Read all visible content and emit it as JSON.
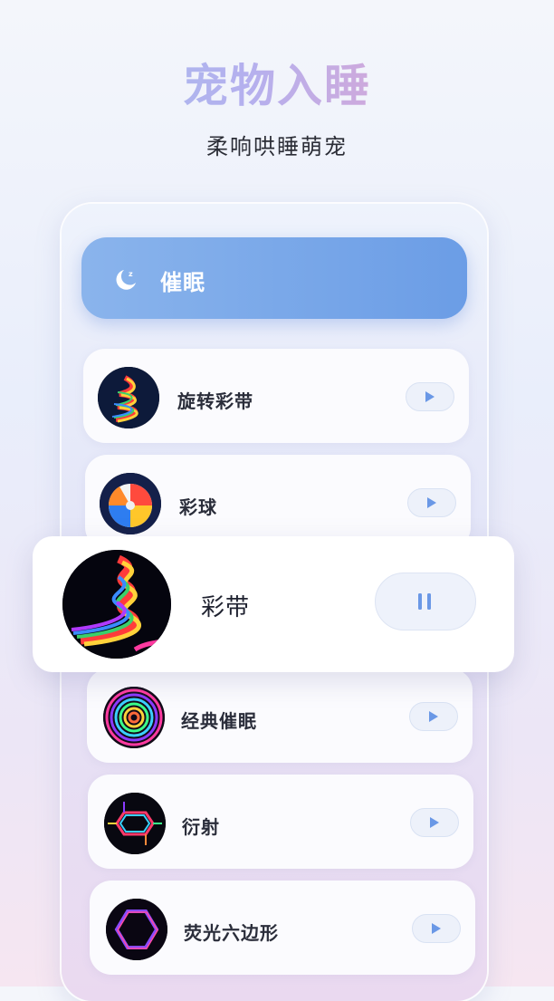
{
  "header": {
    "title": "宠物入睡",
    "subtitle": "柔响哄睡萌宠"
  },
  "mode": {
    "label": "催眠",
    "icon": "moon-sleep-icon"
  },
  "items": [
    {
      "label": "旋转彩带",
      "icon": "rainbow-spiral-thumbnail",
      "state": "play"
    },
    {
      "label": "彩球",
      "icon": "beach-ball-thumbnail",
      "state": "play"
    },
    {
      "label": "经典催眠",
      "icon": "hypnotic-circles-thumbnail",
      "state": "play"
    },
    {
      "label": "衍射",
      "icon": "diffraction-hexagon-thumbnail",
      "state": "play"
    },
    {
      "label": "荧光六边形",
      "icon": "neon-hexagon-thumbnail",
      "state": "play"
    }
  ],
  "now_playing": {
    "label": "彩带",
    "icon": "rainbow-ribbon-thumbnail",
    "state": "pause"
  },
  "colors": {
    "accent": "#6b9de6",
    "title_gradient": [
      "#9fc2ef",
      "#b5b0ee",
      "#f3a0c2"
    ]
  }
}
